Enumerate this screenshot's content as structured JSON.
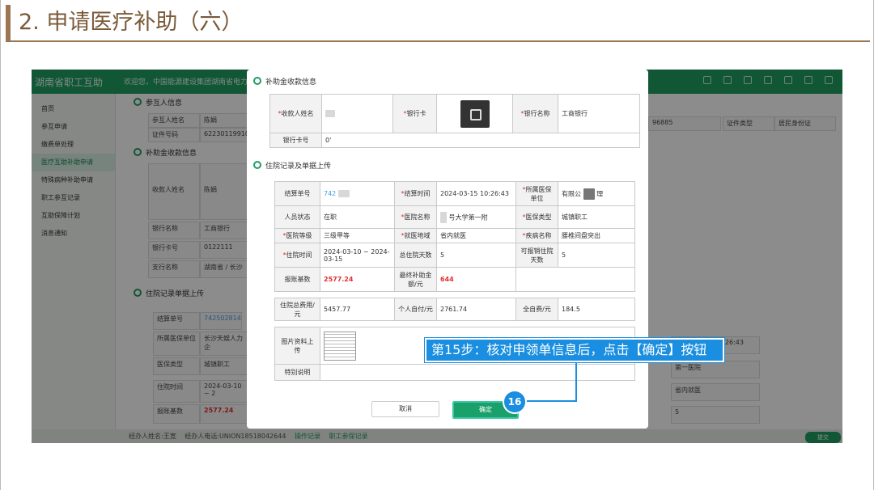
{
  "slide": {
    "title": "2. 申请医疗补助（六）"
  },
  "app": {
    "name": "湖南省职工互助",
    "welcome": "欢迎您，中国能源建设集团湖南省电力",
    "accent": "#1f9d62"
  },
  "sidebar": {
    "items": [
      {
        "label": "首页"
      },
      {
        "label": "参互申请"
      },
      {
        "label": "缴费单处理"
      },
      {
        "label": "医疗互助补助申请"
      },
      {
        "label": "特殊病种补助申请"
      },
      {
        "label": "职工参互记录"
      },
      {
        "label": "互助保障计划"
      },
      {
        "label": "消息通知"
      }
    ]
  },
  "background": {
    "sec1": "参互人信息",
    "sec2": "补助金收款信息",
    "sec3": "住院记录单据上传",
    "name_label": "参互人姓名",
    "name_val": "陈娟",
    "id_label": "证件号码",
    "id_val": "6223011991081C",
    "payee_label": "收款人姓名",
    "payee_val": "陈娟",
    "bankname_label": "银行名称",
    "bankname_val": "工商银行",
    "card_label": "银行卡号",
    "card_val": "0122111",
    "branch_label": "支行名称",
    "branch_val": "湖南省 / 长沙",
    "settle_label": "结算单号",
    "settle_val": "742502814",
    "insured_label": "所属医保单位",
    "insured_val": "长沙天娱人力企",
    "type_label": "医保类型",
    "type_val": "城镇职工",
    "stay_label": "住院时间",
    "stay_val": "2024-03-10 ~ 2",
    "base_label": "报账基数",
    "base_val": "2577.24",
    "right_phone": "96885",
    "right_idtype_label": "证件类型",
    "right_idtype_val": "居民身份证",
    "right_time": "2024-03-15 10:26:43",
    "right_hospital": "第一医院",
    "right_region": "省内就医",
    "right_days": "5",
    "bottom_agent": "经办人姓名:王宽",
    "bottom_phone": "经办人电话:UNION18518042644",
    "bottom_link1": "操作记录",
    "bottom_link2": "职工参保记录",
    "submit_label": "提交"
  },
  "dialog": {
    "payee_section": "补助金收款信息",
    "payee_name_label": "收款人姓名",
    "bank_card_label": "银行卡",
    "bank_name_label": "银行名称",
    "bank_name_val": "工商银行",
    "card_no_label": "银行卡号",
    "card_no_val": "0'",
    "record_section": "住院记录及单据上传",
    "rows": {
      "settle_label": "结算单号",
      "settle_val": "742",
      "settle_time_label": "结算时间",
      "settle_time_val": "2024-03-15 10:26:43",
      "insured_unit_label": "所属医保单位",
      "insured_unit_val1": "有限公",
      "insured_unit_val2": "理",
      "status_label": "人员状态",
      "status_val": "在职",
      "hospital_label": "医院名称",
      "hospital_val": "号大学第一附",
      "insurance_type_label": "医保类型",
      "insurance_type_val": "城镇职工",
      "level_label": "医院等级",
      "level_val": "三级甲等",
      "region_label": "就医地域",
      "region_val": "省内就医",
      "disease_label": "疾病名称",
      "disease_val": "腰椎间盘突出",
      "stay_label": "住院时间",
      "stay_val": "2024-03-10 ~ 2024-03-15",
      "total_days_label": "总住院天数",
      "total_days_val": "5",
      "reimb_days_label": "可报销住院天数",
      "reimb_days_val": "5",
      "base_label": "报账基数",
      "base_val": "2577.24",
      "final_label": "最终补助金额/元",
      "final_val": "644",
      "total_cost_label": "住院总费用/元",
      "total_cost_val": "5457.77",
      "self_pay_label": "个人自付/元",
      "self_pay_val": "2761.74",
      "full_self_label": "全自费/元",
      "full_self_val": "184.5",
      "upload_label": "图片资料上传",
      "notes_label": "特别说明"
    },
    "cancel_label": "取消",
    "confirm_label": "确定"
  },
  "annotation": {
    "step_text": "第15步：核对申领单信息后，点击【确定】按钮",
    "badge": "16",
    "color": "#1a8ee0"
  }
}
